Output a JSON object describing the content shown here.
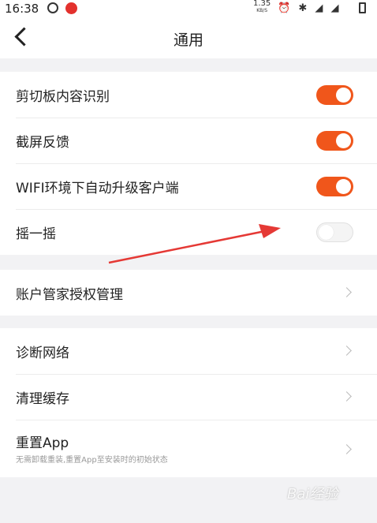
{
  "status_bar": {
    "time": "16:38",
    "speed": "1.35",
    "speed_unit": "KB/S",
    "icons": "⏰ ✱ ◢ ◢"
  },
  "header": {
    "title": "通用"
  },
  "toggles_group": [
    {
      "label": "剪切板内容识别",
      "on": true
    },
    {
      "label": "截屏反馈",
      "on": true
    },
    {
      "label": "WIFI环境下自动升级客户端",
      "on": true
    },
    {
      "label": "摇一摇",
      "on": false
    }
  ],
  "auth_group": [
    {
      "label": "账户管家授权管理"
    }
  ],
  "misc_group": [
    {
      "label": "诊断网络"
    },
    {
      "label": "清理缓存"
    },
    {
      "label": "重置App",
      "sub": "无需卸载重装,重置App至安装时的初始状态"
    }
  ],
  "watermark": "Bai经验",
  "colors": {
    "accent": "#f0561b",
    "background": "#f2f2f4",
    "arrow": "#e53935"
  }
}
